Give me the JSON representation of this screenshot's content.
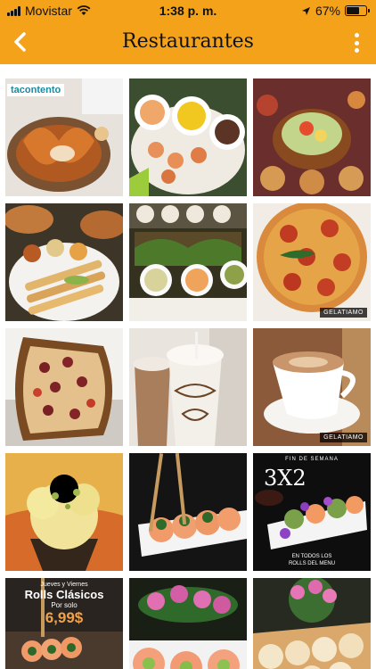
{
  "status_bar": {
    "carrier": "Movistar",
    "time": "1:38 p. m.",
    "battery": "67%",
    "battery_level": 0.67
  },
  "header": {
    "title": "Restaurantes",
    "back_icon": "chevron-left-icon",
    "menu_icon": "more-vertical-icon"
  },
  "colors": {
    "header_bg": "#f5a21b",
    "text": "#111111"
  },
  "grid": {
    "tiles": [
      {
        "subject": "tacontento-fried-tacos",
        "label": "tacontento"
      },
      {
        "subject": "shrimp-and-dips"
      },
      {
        "subject": "mexican-salad-platter"
      },
      {
        "subject": "flautas-platter"
      },
      {
        "subject": "tacos-with-sauces"
      },
      {
        "subject": "pepperoni-pizza",
        "brand": "GELATIAMO"
      },
      {
        "subject": "flatbread-pizza"
      },
      {
        "subject": "frappe-drinks"
      },
      {
        "subject": "cappuccino-cup",
        "brand": "GELATIAMO"
      },
      {
        "subject": "gelato-cone"
      },
      {
        "subject": "sushi-roll-chopsticks"
      },
      {
        "subject": "sushi-promo",
        "promo_top": "FIN DE SEMANA",
        "promo_big": "3X2",
        "promo_bottom_1": "EN TODOS LOS",
        "promo_bottom_2": "ROLLS DEL MENU"
      },
      {
        "subject": "sushi-rolls-promo",
        "promo_day": "Jueves y Viernes",
        "promo_title": "Rolls Clásicos",
        "promo_sub": "Por solo",
        "promo_price": "6,99$"
      },
      {
        "subject": "sushi-with-flowers"
      },
      {
        "subject": "sushi-platter-flowers"
      }
    ]
  }
}
